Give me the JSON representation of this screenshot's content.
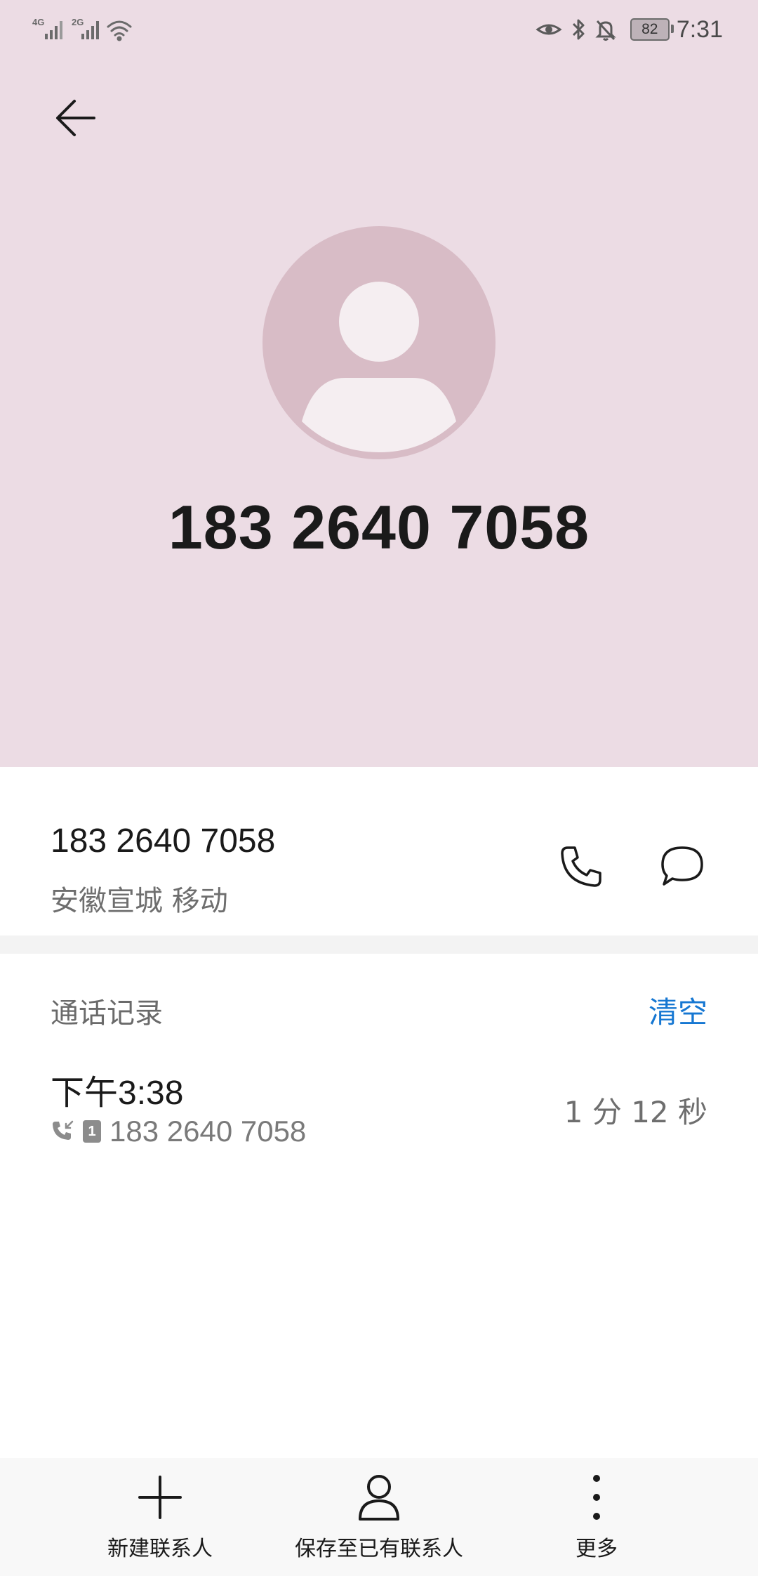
{
  "status_bar": {
    "sim1_network": "4G",
    "sim2_network": "2G",
    "battery_percent": "82",
    "time": "7:31"
  },
  "header": {
    "back_icon": "arrow-left-icon",
    "avatar_icon": "default-person-avatar",
    "phone_number": "183 2640 7058",
    "background_color": "#ecdce4"
  },
  "number_card": {
    "phone_number": "183 2640 7058",
    "location": "安徽宣城 移动",
    "call_icon": "phone-icon",
    "message_icon": "message-bubble-icon"
  },
  "call_log": {
    "title": "通话记录",
    "clear_label": "清空",
    "accent_color": "#1677d2",
    "entries": [
      {
        "time": "下午3:38",
        "direction_icon": "incoming-call-icon",
        "sim_slot": "1",
        "number": "183 2640 7058",
        "duration": "1 分 12 秒"
      }
    ]
  },
  "bottom_bar": {
    "new_contact": {
      "label": "新建联系人",
      "icon": "plus-icon"
    },
    "save_existing": {
      "label": "保存至已有联系人",
      "icon": "person-icon"
    },
    "more": {
      "label": "更多",
      "icon": "more-vertical-icon"
    }
  }
}
